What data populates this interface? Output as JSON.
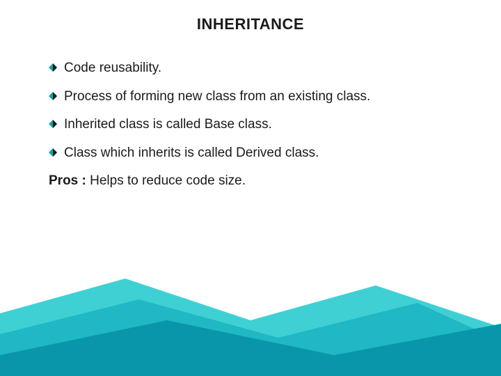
{
  "title": "INHERITANCE",
  "bullets": [
    {
      "text": "Code reusability."
    },
    {
      "text": "Process of forming new class from an existing class."
    },
    {
      "text": "Inherited class is called Base class."
    },
    {
      "text": "Class which inherits is called Derived class."
    }
  ],
  "pros": {
    "label": "Pros : ",
    "text": "Helps to reduce code size."
  },
  "colors": {
    "bullet_teal": "#0aa8a8",
    "bullet_dark": "#1a1a1a",
    "footer_teal_light": "#3fd0d4",
    "footer_teal_mid": "#1fb8c4",
    "footer_teal_dark": "#0a96aa"
  }
}
